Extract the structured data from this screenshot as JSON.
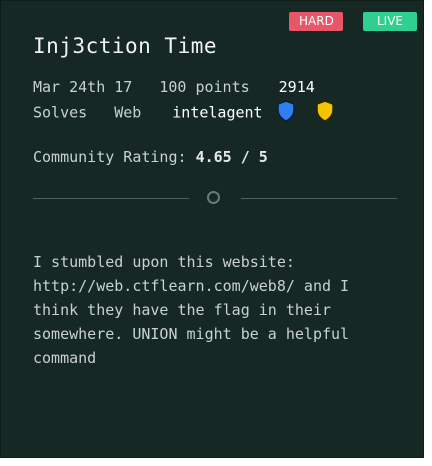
{
  "badges": {
    "difficulty": "HARD",
    "status": "LIVE"
  },
  "challenge": {
    "title": "Inj3ction Time",
    "date": "Mar 24th 17",
    "points": "100 points",
    "solves_count": "2914",
    "solves_label": "Solves",
    "category": "Web",
    "author": "intelagent",
    "icons": [
      "blue-shield-icon",
      "gold-shield-icon"
    ]
  },
  "rating": {
    "label": "Community Rating:",
    "value": "4.65 / 5"
  },
  "description": "I stumbled upon this website:\nhttp://web.ctflearn.com/web8/ and I\nthink they have the flag in their\nsomewhere. UNION might be a helpful\ncommand",
  "colors": {
    "card_background": "#162824",
    "hard_badge": "#e8566a",
    "live_badge": "#2fcf90",
    "blue_shield": "#2f80ed",
    "gold_shield": "#f2c500"
  }
}
